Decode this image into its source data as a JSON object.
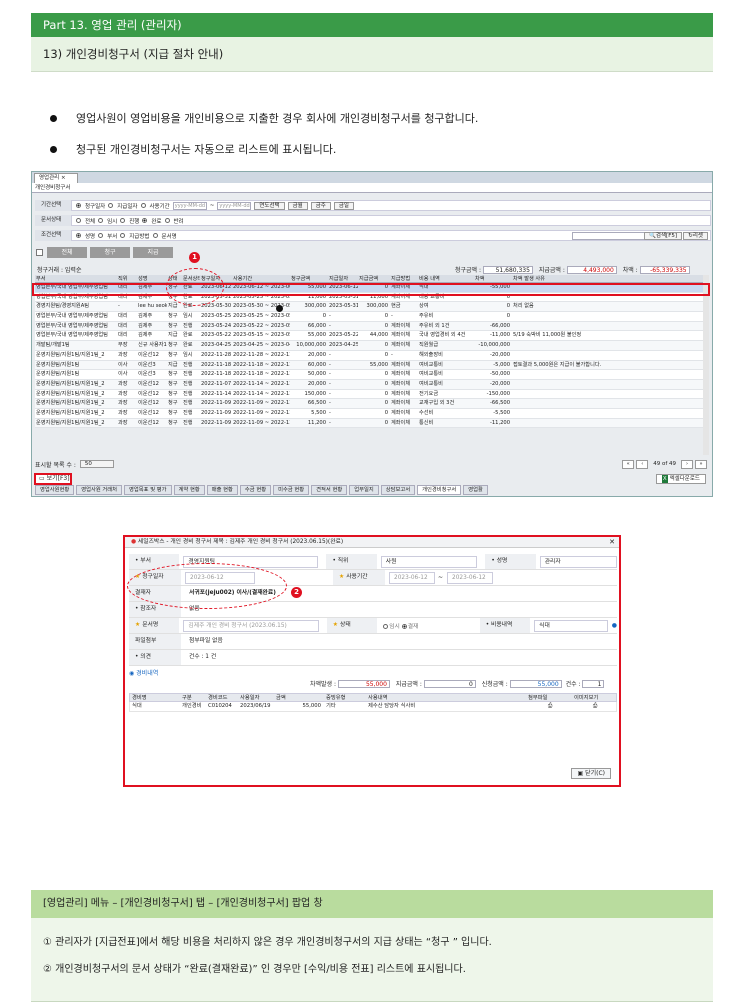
{
  "header": {
    "title": "Part 13. 영업 관리 (관리자)",
    "subtitle": "13) 개인경비청구서 (지급 절차 안내)"
  },
  "bullets": [
    "영업사원이 영업비용을 개인비용으로 지출한 경우 회사에 개인경비청구서를 청구합니다.",
    "청구된 개인경비청구서는 자동으로 리스트에 표시됩니다."
  ],
  "screen": {
    "tab": "영업관리 ×",
    "window_title": "개인경비청구서",
    "filters": {
      "period_label": "기간선택",
      "period_options": [
        "청구일자",
        "지급일자",
        "사용기간"
      ],
      "date_placeholder": "yyyy-MM-dd",
      "year_select": "연도선택",
      "quick": [
        "금월",
        "금주",
        "금일"
      ],
      "docstate_label": "문서상태",
      "docstate_options": [
        "전체",
        "임시",
        "진행",
        "완료",
        "반려"
      ],
      "cond_label": "조건선택",
      "cond_options": [
        "성명",
        "부서",
        "지급방법",
        "문서명"
      ],
      "search_btn": "검색[F5]",
      "reset_btn": "리셋"
    },
    "grid_buttons": [
      "전체",
      "청구",
      "지급"
    ],
    "summary": {
      "left": "청구거래 : 입력순",
      "claim_label": "청구금액 :",
      "claim_value": "51,680,335",
      "paid_label": "지급금액 :",
      "paid_value": "4,493,000",
      "diff_label": "차액 :",
      "diff_value": "-65,339,335"
    },
    "columns": [
      "부서",
      "직위",
      "성명",
      "상태",
      "문서상태",
      "청구일자",
      "사용기간",
      "청구금액",
      "지급일자",
      "지급금액",
      "지급방법",
      "비용 내역",
      "차액",
      "차액 발생 사유"
    ],
    "rows": [
      [
        "영업본부/국내 영업부/제주영업팀",
        "대리",
        "김제주",
        "청구",
        "완료",
        "2023-06-12",
        "2023-06-12 ~ 2023-06-12",
        "55,000",
        "2023-06-12",
        "0",
        "계좌이체",
        "식대",
        "-55,000",
        ""
      ],
      [
        "영업본부/국내 영업부/제주영업팀",
        "대리",
        "김제주",
        "청구",
        "완료",
        "2023-05-31",
        "2023-05-25 ~ 2023-05-25",
        "11,000",
        "2023-05-31",
        "11,000",
        "계좌이체",
        "대량 교통비",
        "0",
        ""
      ],
      [
        "경영지원팀/경영지원A팀",
        "-",
        "lee hu seok",
        "지급",
        "완료",
        "2023-05-30",
        "2023-05-30 ~ 2023-05-30",
        "300,000",
        "2023-05-31",
        "300,000",
        "현금",
        "상여",
        "0",
        "처리 없음"
      ],
      [
        "영업본부/국내 영업부/제주영업팀",
        "대리",
        "김제주",
        "청구",
        "임시",
        "2023-05-25",
        "2023-05-25 ~ 2023-05-25",
        "0",
        "-",
        "0",
        "-",
        "주유비",
        "0",
        ""
      ],
      [
        "영업본부/국내 영업부/제주영업팀",
        "대리",
        "김제주",
        "청구",
        "진행",
        "2023-05-24",
        "2023-05-22 ~ 2023-05-23",
        "66,000",
        "-",
        "0",
        "계좌이체",
        "주유비 외 1건",
        "-66,000",
        ""
      ],
      [
        "영업본부/국내 영업부/제주영업팀",
        "대리",
        "김제주",
        "지급",
        "완료",
        "2023-05-22",
        "2023-05-15 ~ 2023-05-19",
        "55,000",
        "2023-05-22",
        "44,000",
        "계좌이체",
        "국내 영업경비 외 4건",
        "-11,000",
        "5/19 숙박비 11,000원 불인정"
      ],
      [
        "개발팀/개발1팀",
        "부장",
        "신규 사용자12",
        "청구",
        "완료",
        "2023-04-25",
        "2023-04-25 ~ 2023-04-25",
        "10,000,000",
        "2023-04-25",
        "0",
        "계좌이체",
        "직원월급",
        "-10,000,000",
        ""
      ],
      [
        "운영지원팀/지원1팀/지원1팀_2",
        "과장",
        "이운선12",
        "청구",
        "임시",
        "2022-11-28",
        "2022-11-28 ~ 2022-11-28",
        "20,000",
        "-",
        "0",
        "-",
        "해외출장비",
        "-20,000",
        ""
      ],
      [
        "운영지원팀/지원1팀",
        "이사",
        "이운선3",
        "지급",
        "진행",
        "2022-11-18",
        "2022-11-18 ~ 2022-11-18",
        "60,000",
        "-",
        "55,000",
        "계좌이체",
        "여비교통비",
        "-5,000",
        "접토결과 5,000원은 지급이 불가합니다."
      ],
      [
        "운영지원팀/지원1팀",
        "이사",
        "이운선3",
        "청구",
        "진행",
        "2022-11-18",
        "2022-11-18 ~ 2022-11-18",
        "50,000",
        "-",
        "0",
        "계좌이체",
        "여비교통비",
        "-50,000",
        ""
      ],
      [
        "운영지원팀/지원1팀/지원1팀_2",
        "과장",
        "이운선12",
        "청구",
        "진행",
        "2022-11-07",
        "2022-11-14 ~ 2022-11-14",
        "20,000",
        "-",
        "0",
        "계좌이체",
        "여비교통비",
        "-20,000",
        ""
      ],
      [
        "운영지원팀/지원1팀/지원1팀_2",
        "과장",
        "이운선12",
        "청구",
        "진행",
        "2022-11-14",
        "2022-11-14 ~ 2022-11-14",
        "150,000",
        "-",
        "0",
        "계좌이체",
        "전기요금",
        "-150,000",
        ""
      ],
      [
        "운영지원팀/지원1팀/지원1팀_2",
        "과장",
        "이운선12",
        "청구",
        "진행",
        "2022-11-09",
        "2022-11-09 ~ 2022-11-09",
        "66,500",
        "-",
        "0",
        "계좌이체",
        "교재구입 외 3건",
        "-66,500",
        ""
      ],
      [
        "운영지원팀/지원1팀/지원1팀_2",
        "과장",
        "이운선12",
        "청구",
        "진행",
        "2022-11-09",
        "2022-11-09 ~ 2022-11-09",
        "5,500",
        "-",
        "0",
        "계좌이체",
        "수선비",
        "-5,500",
        ""
      ],
      [
        "운영지원팀/지원1팀/지원1팀_2",
        "과장",
        "이운선12",
        "청구",
        "진행",
        "2022-11-09",
        "2022-11-09 ~ 2022-11-09",
        "11,200",
        "-",
        "0",
        "계좌이체",
        "통신비",
        "-11,200",
        ""
      ]
    ],
    "footer": {
      "per_page_label": "표시할 목록 수 :",
      "per_page_value": "50",
      "page_info": "49 of 49"
    },
    "view_btn": "보기[F3]",
    "excel_btn": "엑셀다운로드",
    "bottom_tabs": [
      "영업사원현황",
      "영업사원 거래처",
      "영업목표 및 평가",
      "계약 현황",
      "매출 현황",
      "수금 현황",
      "미수금 현황",
      "견적서 현황",
      "업무일지",
      "상담보고서",
      "개인경비청구서",
      "영업활"
    ],
    "markers": [
      "1",
      "2"
    ]
  },
  "popup": {
    "title": "세일즈박스 - 개인 경비 청구서 제목 : 김제주 개인 경비 청구서 (2023.06.15)(완료)",
    "fields": {
      "dept_label": "부서",
      "dept_value": "경영지원팀",
      "pos_label": "직위",
      "pos_value": "사원",
      "name_label": "성명",
      "name_value": "관리자",
      "claimdate_label": "청구일자",
      "claimdate_value": "2023-06-12",
      "useperiod_label": "사용기간",
      "use_from": "2023-06-12",
      "use_to": "2023-06-12",
      "approver_label": "결재자",
      "approver_value": "서귀포(jeju002) 이사/(결재완료)",
      "ref_label": "참조자",
      "ref_value": "없음",
      "docname_label": "문서명",
      "docname_value": "김제주 개인 경비 청구서 (2023.06.15)",
      "state_label": "상태",
      "state_options": [
        "임시",
        "결재"
      ],
      "costdetail_label": "비용내역",
      "costdetail_value": "식대",
      "attach_label": "파일첨부",
      "attach_value": "첨부파일 없음",
      "opinion_label": "의견",
      "opinion_value": "건수 : 1 건"
    },
    "expense": {
      "section": "경비내역",
      "diff_label": "차액발생 :",
      "diff_value": "55,000",
      "paid_label": "지급금액 :",
      "paid_value": "0",
      "claim_label": "신청금액 :",
      "claim_value": "55,000",
      "count_label": "건수 :",
      "count_value": "1",
      "columns": [
        "경비명",
        "구분",
        "경비코드",
        "사용일자",
        "금액",
        "증빙유형",
        "사용내역",
        "첨부파일",
        "이미지보기"
      ],
      "row": [
        "식대",
        "개인경비",
        "C010204",
        "2023/06/19",
        "55,000",
        "기타",
        "제수산 담당자 식사비"
      ]
    },
    "close_btn": "닫기(C)"
  },
  "explain": {
    "header": "[영업관리] 메뉴 – [개인경비청구서] 탭 – [개인경비청구서] 팝업 창",
    "lines": [
      "①  관리자가 [지급전표]에서 해당 비용을 처리하지 않은 경우 개인경비청구서의 지급 상태는 “청구 ” 입니다.",
      "②  개인경비청구서의 문서 상태가 “완료(결재완료)” 인 경우만 [수익/비용 전표] 리스트에 표시됩니다."
    ]
  }
}
